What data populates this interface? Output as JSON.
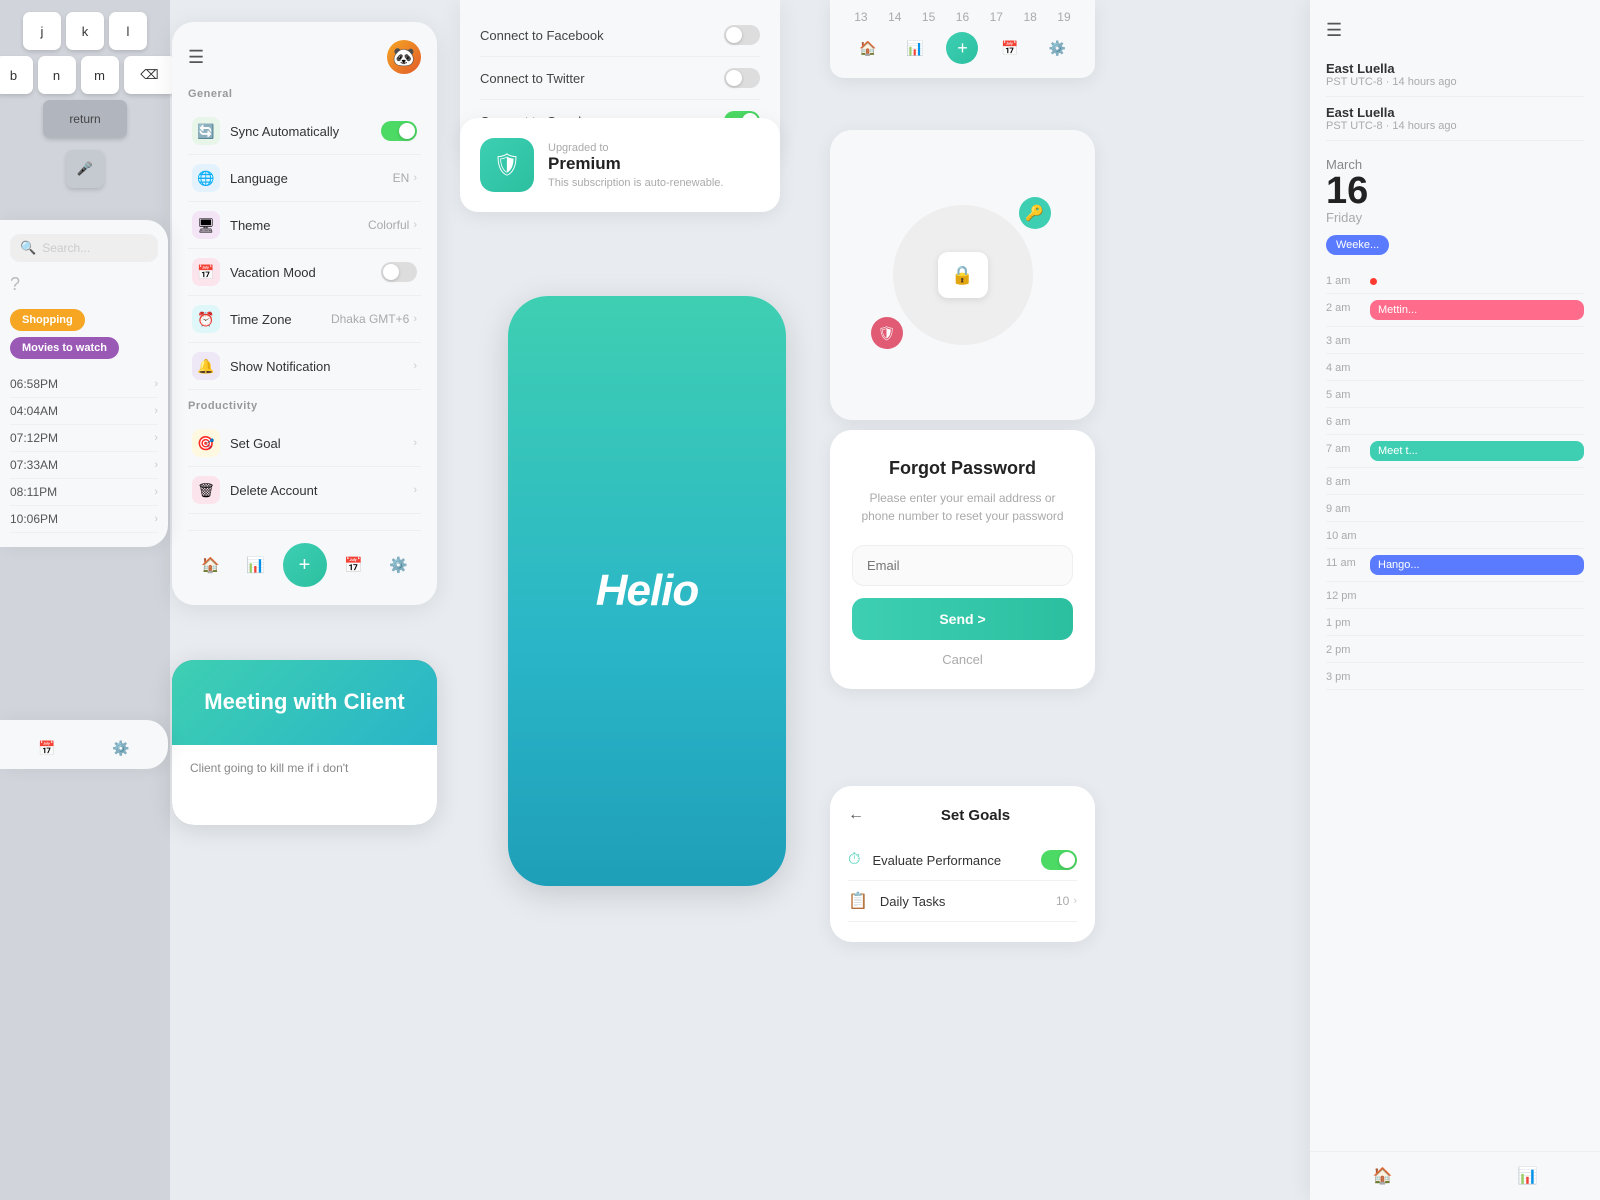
{
  "keyboard": {
    "rows": [
      [
        "j",
        "k",
        "l"
      ],
      [
        "b",
        "n",
        "m"
      ]
    ],
    "return_label": "return",
    "mic_icon": "🎤"
  },
  "settings": {
    "section_general": "General",
    "section_productivity": "Productivity",
    "header_menu_icon": "☰",
    "avatar_emoji": "🐼",
    "items": [
      {
        "id": "sync",
        "label": "Sync Automatically",
        "type": "toggle",
        "value": "on",
        "icon": "🔄",
        "icon_bg": "#e8f5e9"
      },
      {
        "id": "language",
        "label": "Language",
        "type": "value",
        "value": "EN",
        "icon": "🌐",
        "icon_bg": "#e3f2fd"
      },
      {
        "id": "theme",
        "label": "Theme",
        "type": "value",
        "value": "Colorful",
        "icon": "🖥",
        "icon_bg": "#f3e5f5"
      },
      {
        "id": "vacation",
        "label": "Vacation Mood",
        "type": "toggle",
        "value": "off",
        "icon": "📅",
        "icon_bg": "#fce4ec"
      },
      {
        "id": "timezone",
        "label": "Time Zone",
        "type": "value",
        "value": "Dhaka GMT+6",
        "icon": "⏰",
        "icon_bg": "#e0f7fa"
      },
      {
        "id": "notification",
        "label": "Show Notification",
        "type": "nav",
        "icon": "🔔",
        "icon_bg": "#ede7f6"
      }
    ],
    "productivity_items": [
      {
        "id": "setgoal",
        "label": "Set Goal",
        "icon": "🎯",
        "icon_bg": "#fff8e1"
      },
      {
        "id": "delete",
        "label": "Delete Account",
        "icon": "🗑",
        "icon_bg": "#fce4ec"
      }
    ],
    "nav": {
      "home_icon": "🏠",
      "chart_icon": "📊",
      "add_icon": "+",
      "calendar_icon": "📅",
      "gear_icon": "⚙️"
    }
  },
  "meeting_card": {
    "title": "Meeting with Client",
    "body_text": "Client going to kill me if i don't"
  },
  "social_connect": {
    "items": [
      {
        "label": "Connect to Facebook",
        "toggle": "off"
      },
      {
        "label": "Connect to Twitter",
        "toggle": "off"
      },
      {
        "label": "Connect to Google+",
        "toggle": "on"
      }
    ]
  },
  "premium": {
    "upgraded_label": "Upgraded to",
    "title": "Premium",
    "subtitle": "This subscription is auto-renewable.",
    "icon": "🛡"
  },
  "helio": {
    "text": "Helio"
  },
  "forgot_password": {
    "title": "Forgot Password",
    "subtitle": "Please enter your email address or phone number to reset your password",
    "email_placeholder": "Email",
    "send_label": "Send >",
    "cancel_label": "Cancel"
  },
  "set_goals": {
    "title": "Set Goals",
    "back_icon": "←",
    "items": [
      {
        "label": "Evaluate Performance",
        "toggle": "on"
      },
      {
        "label": "Daily Tasks",
        "count": "10",
        "chevron": ">"
      }
    ]
  },
  "schedule": {
    "clocks": [
      {
        "city": "East Luella",
        "meta": "PST UTC-8 · 14 hours ago"
      },
      {
        "city": "East Luella",
        "meta": "PST UTC-8 · 14 hours ago"
      }
    ],
    "month": "March",
    "day": "16",
    "day_name": "Friday",
    "week_badge": "Weeke...",
    "time_slots": [
      {
        "time": "1 am",
        "event": null,
        "dot": true
      },
      {
        "time": "2 am",
        "event": "Mettin...",
        "color": "pink"
      },
      {
        "time": "3 am",
        "event": null,
        "dot": false
      },
      {
        "time": "4 am",
        "event": null,
        "dot": false
      },
      {
        "time": "5 am",
        "event": null,
        "dot": false
      },
      {
        "time": "6 am",
        "event": null,
        "dot": false
      },
      {
        "time": "7 am",
        "event": "Meet t...",
        "color": "teal"
      },
      {
        "time": "8 am",
        "event": null,
        "dot": false
      },
      {
        "time": "9 am",
        "event": null,
        "dot": false
      },
      {
        "time": "10 am",
        "event": null,
        "dot": false
      },
      {
        "time": "11 am",
        "event": "Hango...",
        "color": "blue"
      },
      {
        "time": "12 pm",
        "event": null,
        "dot": false
      },
      {
        "time": "1 pm",
        "event": null,
        "dot": false
      },
      {
        "time": "2 pm",
        "event": null,
        "dot": false
      },
      {
        "time": "3 pm",
        "event": null,
        "dot": false
      }
    ]
  },
  "activity": {
    "search_placeholder": "Search...",
    "question_mark": "?",
    "tags": [
      {
        "label": "Shopping",
        "color": "shopping"
      },
      {
        "label": "Movies to watch",
        "color": "movies"
      }
    ],
    "times": [
      {
        "time": "06:58PM"
      },
      {
        "time": "04:04AM"
      },
      {
        "time": "07:12PM"
      },
      {
        "time": "07:33AM"
      },
      {
        "time": "08:11PM"
      },
      {
        "time": "10:06PM"
      }
    ]
  }
}
